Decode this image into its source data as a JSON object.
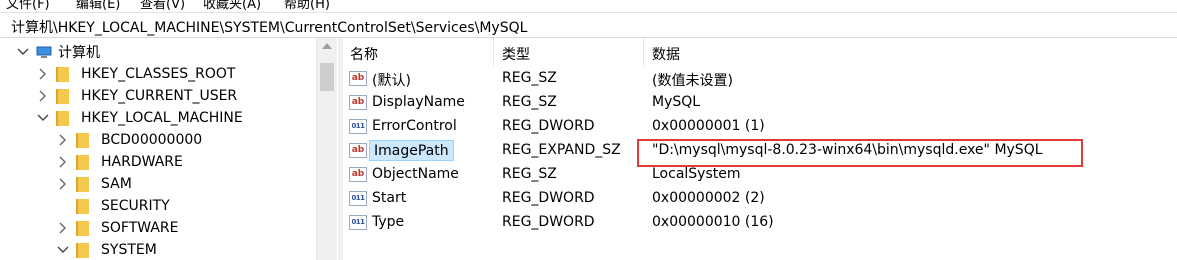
{
  "menu": [
    "文件(F)",
    "编辑(E)",
    "查看(V)",
    "收藏夹(A)",
    "帮助(H)"
  ],
  "address": "计算机\\HKEY_LOCAL_MACHINE\\SYSTEM\\CurrentControlSet\\Services\\MySQL",
  "left_edge_text": ")",
  "tree": [
    {
      "label": "计算机",
      "level": 0,
      "expanded": true,
      "icon": "computer-icon"
    },
    {
      "label": "HKEY_CLASSES_ROOT",
      "level": 1,
      "expanded": false,
      "icon": "folder-icon"
    },
    {
      "label": "HKEY_CURRENT_USER",
      "level": 1,
      "expanded": false,
      "icon": "folder-icon"
    },
    {
      "label": "HKEY_LOCAL_MACHINE",
      "level": 1,
      "expanded": true,
      "icon": "folder-icon"
    },
    {
      "label": "BCD00000000",
      "level": 2,
      "expanded": false,
      "icon": "folder-icon"
    },
    {
      "label": "HARDWARE",
      "level": 2,
      "expanded": false,
      "icon": "folder-icon"
    },
    {
      "label": "SAM",
      "level": 2,
      "expanded": false,
      "icon": "folder-icon"
    },
    {
      "label": "SECURITY",
      "level": 2,
      "expanded": null,
      "icon": "folder-icon"
    },
    {
      "label": "SOFTWARE",
      "level": 2,
      "expanded": false,
      "icon": "folder-icon"
    },
    {
      "label": "SYSTEM",
      "level": 2,
      "expanded": true,
      "icon": "folder-icon"
    }
  ],
  "columns": {
    "name": "名称",
    "type": "类型",
    "data": "数据"
  },
  "values": [
    {
      "name": "(默认)",
      "type": "REG_SZ",
      "data": "(数值未设置)",
      "icon": "string-value-icon"
    },
    {
      "name": "DisplayName",
      "type": "REG_SZ",
      "data": "MySQL",
      "icon": "string-value-icon"
    },
    {
      "name": "ErrorControl",
      "type": "REG_DWORD",
      "data": "0x00000001 (1)",
      "icon": "binary-value-icon"
    },
    {
      "name": "ImagePath",
      "type": "REG_EXPAND_SZ",
      "data": "\"D:\\mysql\\mysql-8.0.23-winx64\\bin\\mysqld.exe\" MySQL",
      "icon": "string-value-icon",
      "selected": true
    },
    {
      "name": "ObjectName",
      "type": "REG_SZ",
      "data": "LocalSystem",
      "icon": "string-value-icon"
    },
    {
      "name": "Start",
      "type": "REG_DWORD",
      "data": "0x00000002 (2)",
      "icon": "binary-value-icon"
    },
    {
      "name": "Type",
      "type": "REG_DWORD",
      "data": "0x00000010 (16)",
      "icon": "binary-value-icon"
    }
  ],
  "icon_glyphs": {
    "string": "ab",
    "binary": "011"
  },
  "colors": {
    "selection": "#cce8ff",
    "highlight_box": "#e53935",
    "folder": "#f2c94c"
  }
}
